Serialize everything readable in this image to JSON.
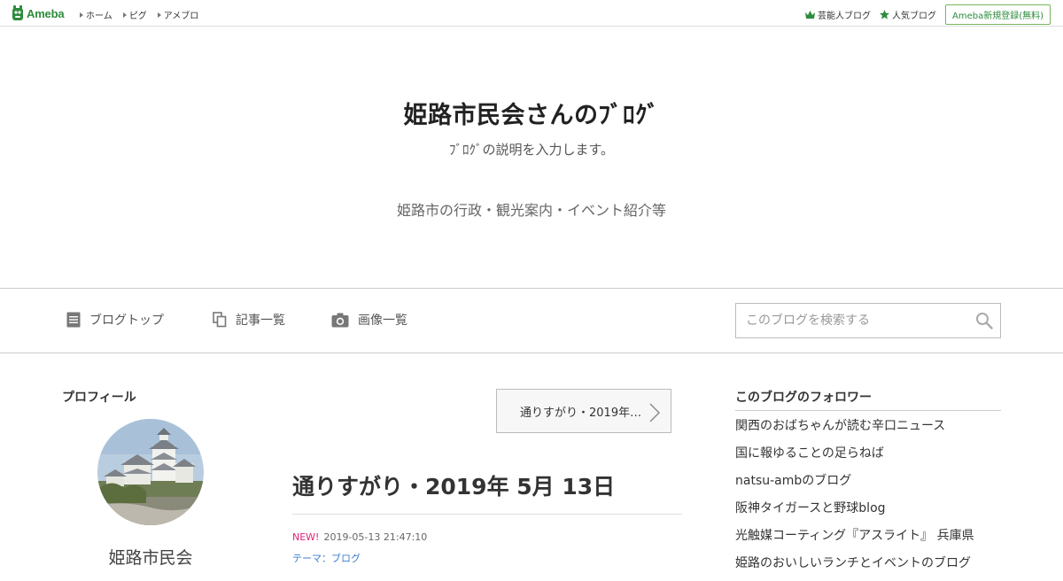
{
  "topbar": {
    "logo_text": "Ameba",
    "nav": [
      "ホーム",
      "ピグ",
      "アメブロ"
    ],
    "right_links": [
      "芸能人ブログ",
      "人気ブログ"
    ],
    "register_button": "Ameba新規登録(無料)"
  },
  "header": {
    "title": "姫路市民会さんのﾌﾞﾛｸﾞ",
    "description": "ﾌﾞﾛｸﾞの説明を入力します。",
    "tagline": "姫路市の行政・観光案内・イベント紹介等"
  },
  "navbar": {
    "items": [
      "ブログトップ",
      "記事一覧",
      "画像一覧"
    ],
    "search_placeholder": "このブログを検索する"
  },
  "profile": {
    "heading": "プロフィール",
    "name": "姫路市民会"
  },
  "entry": {
    "prev_label": "通りすがり・2019年…",
    "title": "通りすがり・2019年 5月 13日",
    "new_badge": "NEW!",
    "datetime": "2019-05-13 21:47:10",
    "theme": "テーマ：ブログ"
  },
  "followers": {
    "heading": "このブログのフォロワー",
    "items": [
      "関西のおばちゃんが読む辛口ニュース",
      "国に報ゆることの足らねば",
      "natsu-ambのブログ",
      "阪神タイガースと野球blog",
      "光触媒コーティング『アスライト』 兵庫県",
      "姫路のおいしいランチとイベントのブログ"
    ]
  },
  "colors": {
    "brand_green": "#2d8c3c",
    "new_badge": "#e3217a",
    "link_blue": "#3b7ec9"
  }
}
